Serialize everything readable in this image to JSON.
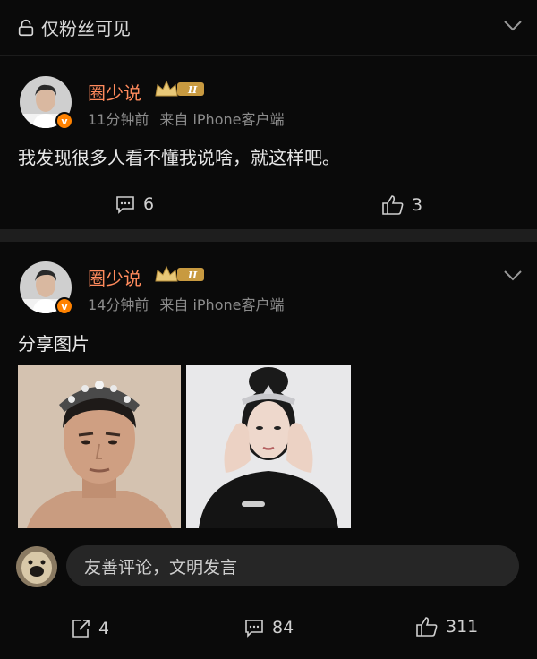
{
  "topbar": {
    "title": "仅粉丝可见"
  },
  "posts": [
    {
      "username": "圈少说",
      "rank": "II",
      "time": "11分钟前",
      "source": "来自 iPhone客户端",
      "text": "我发现很多人看不懂我说啥，就这样吧。",
      "comments": "6",
      "likes": "3"
    },
    {
      "username": "圈少说",
      "rank": "II",
      "time": "14分钟前",
      "source": "来自 iPhone客户端",
      "text": "分享图片",
      "comment_placeholder": "友善评论，文明发言",
      "reposts": "4",
      "comments": "84",
      "likes": "311"
    }
  ],
  "colors": {
    "username": "#ff8a5c",
    "badge": "#ff8200",
    "background": "#0a0a0a"
  }
}
